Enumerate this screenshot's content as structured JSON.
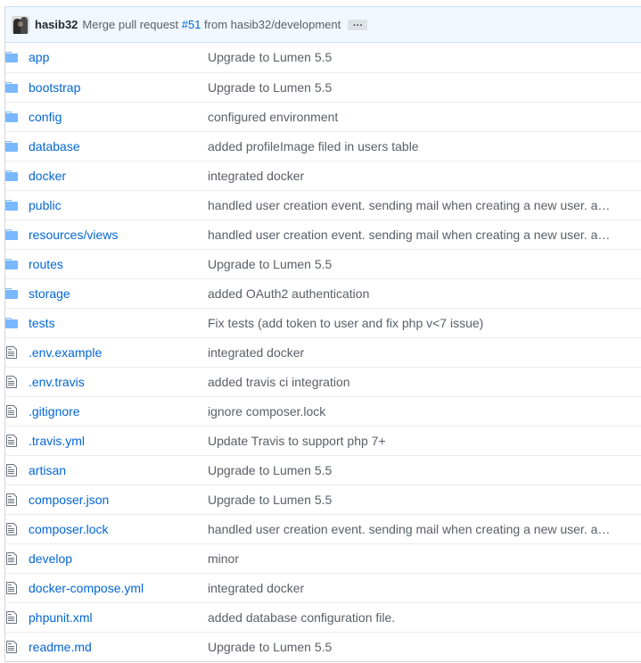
{
  "commit": {
    "author": "hasib32",
    "message_prefix": "Merge pull request",
    "pr_link": "#51",
    "message_suffix": "from hasib32/development",
    "ellipsis": "…"
  },
  "files": [
    {
      "name": "app",
      "type": "folder",
      "icon": "folder-icon",
      "message": "Upgrade to Lumen 5.5"
    },
    {
      "name": "bootstrap",
      "type": "folder",
      "icon": "folder-icon",
      "message": "Upgrade to Lumen 5.5"
    },
    {
      "name": "config",
      "type": "folder",
      "icon": "folder-icon",
      "message": "configured environment"
    },
    {
      "name": "database",
      "type": "folder",
      "icon": "folder-icon",
      "message": "added profileImage filed in users table"
    },
    {
      "name": "docker",
      "type": "folder",
      "icon": "folder-icon",
      "message": "integrated docker"
    },
    {
      "name": "public",
      "type": "folder",
      "icon": "folder-icon",
      "message": "handled user creation event. sending mail when creating a new user. a…"
    },
    {
      "name": "resources/views",
      "type": "folder",
      "icon": "folder-icon",
      "message": "handled user creation event. sending mail when creating a new user. a…"
    },
    {
      "name": "routes",
      "type": "folder",
      "icon": "folder-icon",
      "message": "Upgrade to Lumen 5.5"
    },
    {
      "name": "storage",
      "type": "folder",
      "icon": "folder-icon",
      "message": "added OAuth2 authentication"
    },
    {
      "name": "tests",
      "type": "folder",
      "icon": "folder-icon",
      "message": "Fix tests (add token to user and fix php v<7 issue)"
    },
    {
      "name": ".env.example",
      "type": "file",
      "icon": "file-icon",
      "message": "integrated docker"
    },
    {
      "name": ".env.travis",
      "type": "file",
      "icon": "file-icon",
      "message": "added travis ci integration"
    },
    {
      "name": ".gitignore",
      "type": "file",
      "icon": "file-icon",
      "message": "ignore composer.lock"
    },
    {
      "name": ".travis.yml",
      "type": "file",
      "icon": "file-icon",
      "message": "Update Travis to support php 7+"
    },
    {
      "name": "artisan",
      "type": "file",
      "icon": "file-icon",
      "message": "Upgrade to Lumen 5.5"
    },
    {
      "name": "composer.json",
      "type": "file",
      "icon": "file-icon",
      "message": "Upgrade to Lumen 5.5"
    },
    {
      "name": "composer.lock",
      "type": "file",
      "icon": "file-icon",
      "message": "handled user creation event. sending mail when creating a new user. a…"
    },
    {
      "name": "develop",
      "type": "file",
      "icon": "file-icon",
      "message": "minor"
    },
    {
      "name": "docker-compose.yml",
      "type": "file",
      "icon": "file-icon",
      "message": "integrated docker"
    },
    {
      "name": "phpunit.xml",
      "type": "file",
      "icon": "file-icon",
      "message": "added database configuration file."
    },
    {
      "name": "readme.md",
      "type": "file",
      "icon": "file-icon",
      "message": "Upgrade to Lumen 5.5"
    }
  ],
  "colors": {
    "link": "#0366d6",
    "folder_icon": "#79b8ff",
    "file_icon": "#6a737d",
    "commit_bar_bg": "#f1f8ff"
  }
}
